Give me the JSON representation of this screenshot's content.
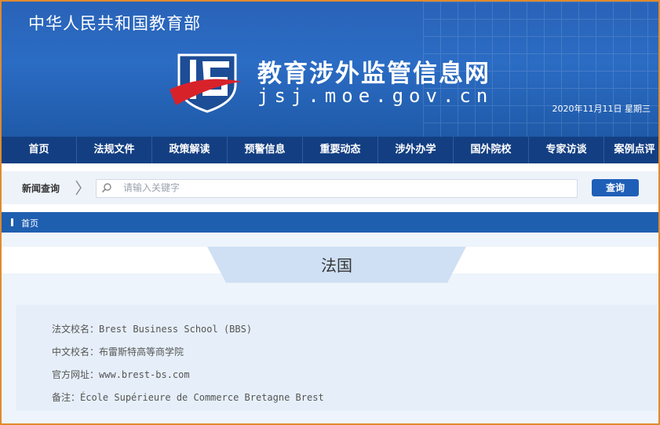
{
  "header": {
    "ministry": "中华人民共和国教育部",
    "site_title": "教育涉外监管信息网",
    "site_url": "jsj.moe.gov.cn",
    "date": "2020年11月11日  星期三"
  },
  "nav": {
    "items": [
      {
        "label": "首页"
      },
      {
        "label": "法规文件"
      },
      {
        "label": "政策解读"
      },
      {
        "label": "预警信息"
      },
      {
        "label": "重要动态"
      },
      {
        "label": "涉外办学"
      },
      {
        "label": "国外院校"
      },
      {
        "label": "专家访谈"
      },
      {
        "label": "案例点评"
      }
    ]
  },
  "search": {
    "label": "新闻查询",
    "placeholder": "请输入关键字",
    "value": "",
    "button": "查询"
  },
  "breadcrumb": {
    "home": "首页"
  },
  "page": {
    "title": "法国"
  },
  "info": {
    "rows": [
      {
        "label": "法文校名：",
        "value": "Brest Business School (BBS)"
      },
      {
        "label": "中文校名：",
        "value": "布雷斯特高等商学院"
      },
      {
        "label": "官方网址：",
        "value": "www.brest-bs.com"
      },
      {
        "label": "备注：",
        "value": "École Supérieure de Commerce Bretagne Brest"
      }
    ]
  },
  "colors": {
    "header_blue": "#2b6cc4",
    "nav_blue": "#133f82",
    "accent_red": "#d8222a",
    "frame_orange": "#e08a2e"
  }
}
